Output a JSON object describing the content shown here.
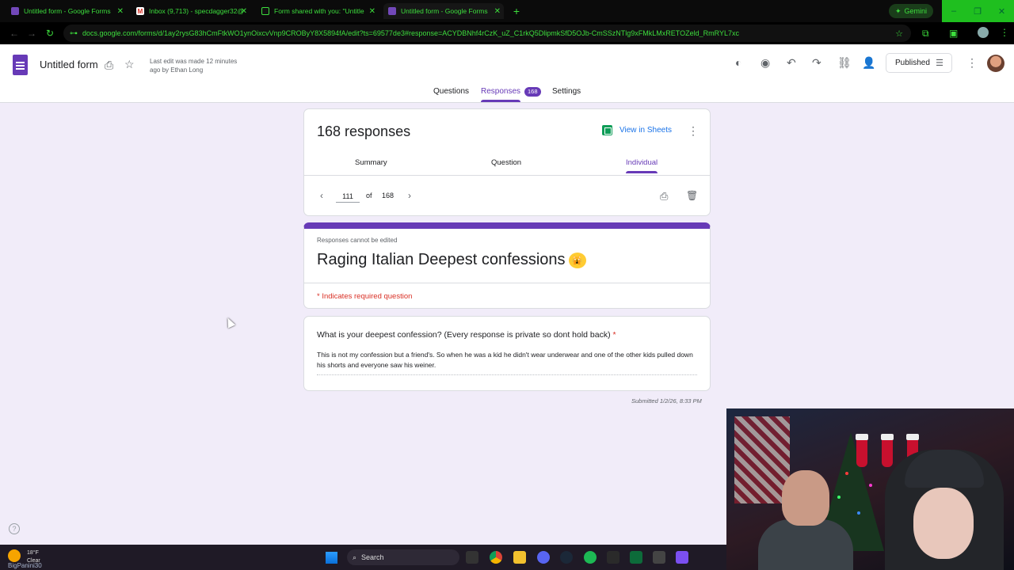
{
  "browser": {
    "tabs": [
      {
        "label": "Untitled form - Google Forms"
      },
      {
        "label": "Inbox (9,713) - specdagger32@"
      },
      {
        "label": "Form shared with you: \"Untitle"
      },
      {
        "label": "Untitled form - Google Forms"
      }
    ],
    "gemini_label": "Gemini",
    "url": "docs.google.com/forms/d/1ay2rysG83hCmFtkWO1ynOixcvVnp9CROByY8X5894fA/edit?ts=69577de3#response=ACYDBNhf4rCzK_uZ_C1rkQ5DlipmkSfD5OJb-CmSSzNTlg9xFMkLMxRETOZeld_RmRYL7xc"
  },
  "header": {
    "form_title": "Untitled form",
    "last_edit": "Last edit was made 12 minutes ago by Ethan Long",
    "publish_label": "Published",
    "tabs": {
      "questions": "Questions",
      "responses": "Responses",
      "responses_count": "168",
      "settings": "Settings"
    }
  },
  "responses": {
    "count_title": "168 responses",
    "view_in_sheets": "View in Sheets",
    "subtabs": {
      "summary": "Summary",
      "question": "Question",
      "individual": "Individual"
    },
    "pager": {
      "current": "111",
      "of_label": "of",
      "total": "168"
    }
  },
  "form": {
    "cannot_edit": "Responses cannot be edited",
    "title": "Raging Italian Deepest confessions",
    "required_note": "* Indicates required question",
    "question": "What is your deepest confession? (Every response is private so dont hold back)",
    "required_mark": "*",
    "answer": "This is not my confession but a friend's. So when he was a kid he didn't wear underwear and one of the other kids pulled down his shorts and everyone saw his weiner.",
    "submitted": "Submitted 1/2/26, 8:33 PM"
  },
  "taskbar": {
    "temp": "18°F",
    "weather": "Clear",
    "search_placeholder": "Search",
    "streamer_overlay": "BigPanini30"
  },
  "colors": {
    "accent": "#673ab7",
    "required": "#d93025",
    "link": "#1a73e8",
    "chrome_text": "#3dde3d"
  }
}
